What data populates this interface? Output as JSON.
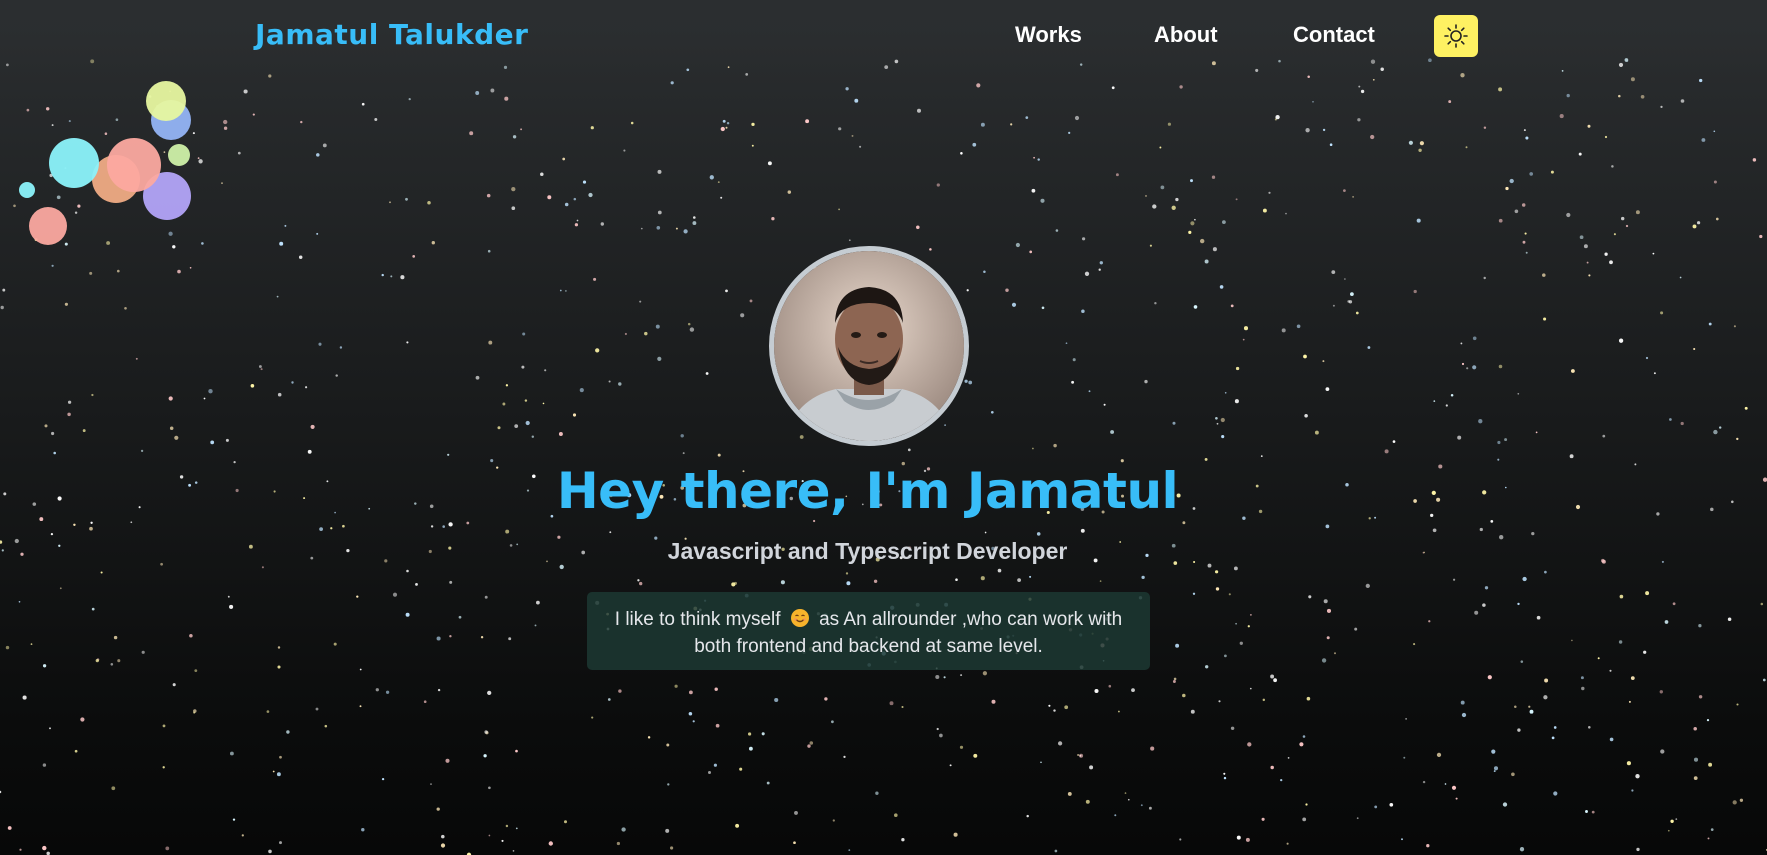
{
  "nav": {
    "brand": "Jamatul Talukder",
    "links": [
      "Works",
      "About",
      "Contact"
    ],
    "theme_toggle_icon": "sun-icon",
    "theme_toggle_color": "#fef162"
  },
  "hero": {
    "title": "Hey there, I'm Jamatul",
    "subtitle": "Javascript and Typescript Developer",
    "bio_before": "I like to think myself",
    "bio_emoji": "smiling-face-icon",
    "bio_after": "as An allrounder ,who can work with both frontend and backend at same level.",
    "avatar_icon": "profile-photo"
  },
  "colors": {
    "accent": "#38bdf8",
    "card": "#1c3832",
    "text": "#e5e7eb"
  }
}
